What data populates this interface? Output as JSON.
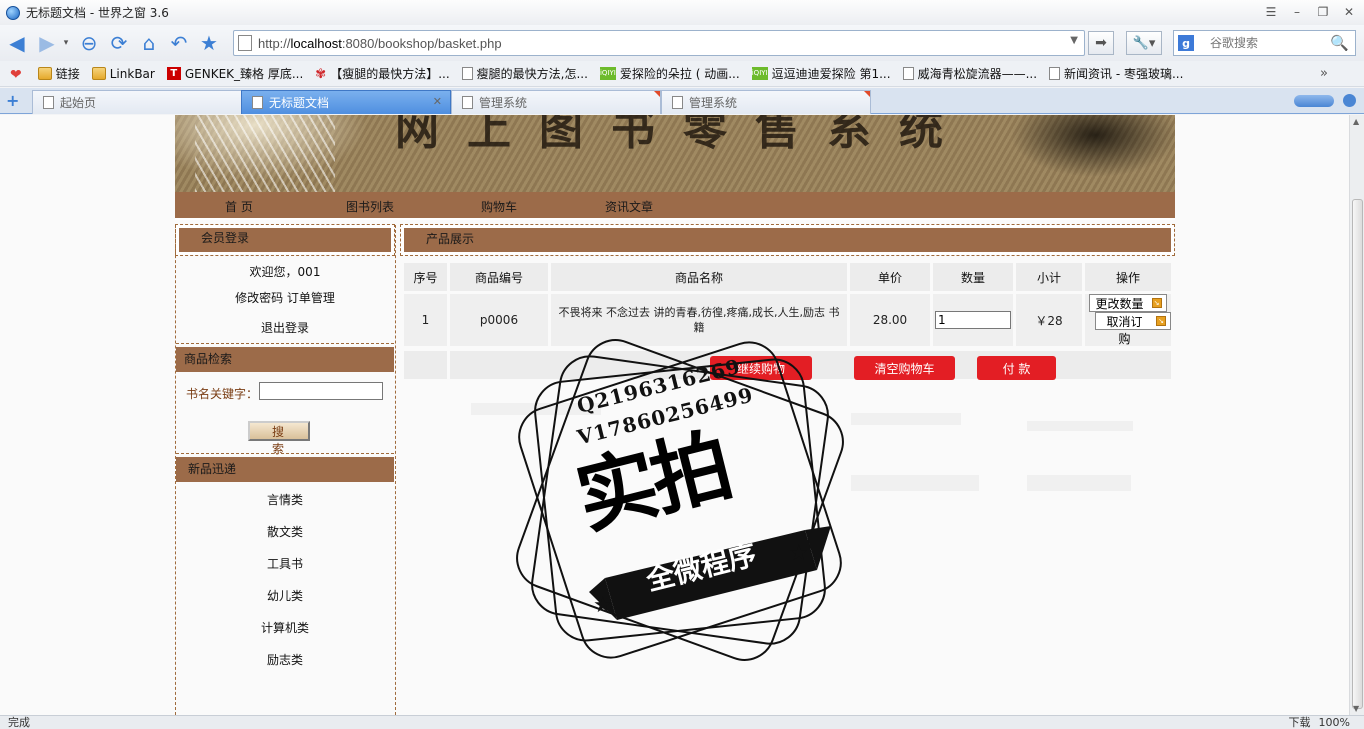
{
  "window": {
    "title": "无标题文档 - 世界之窗 3.6",
    "minimize": "–",
    "restore": "❐",
    "close": "✕"
  },
  "toolbar": {
    "back": "◀",
    "forward": "▶",
    "stop": "⊖",
    "refresh": "⟳",
    "home": "⌂",
    "undo": "↶",
    "favorite": "★",
    "url_prefix": "http://",
    "url_host": "localhost",
    "url_rest": ":8080/bookshop/basket.php",
    "go": "➡",
    "tools": "🔧▾",
    "search_placeholder": "谷歌搜索",
    "search_engine": "g",
    "magnifier": "🔍"
  },
  "bookmarks": [
    {
      "icon": "heart",
      "label": ""
    },
    {
      "icon": "folder",
      "label": "链接"
    },
    {
      "icon": "folder",
      "label": "LinkBar"
    },
    {
      "icon": "t",
      "label": "GENKEK_臻格 厚底..."
    },
    {
      "icon": "red",
      "label": "【瘦腿的最快方法】..."
    },
    {
      "icon": "doc",
      "label": "瘦腿的最快方法,怎..."
    },
    {
      "icon": "iqiyi",
      "label": "爱探险的朵拉 ( 动画..."
    },
    {
      "icon": "iqiyi",
      "label": "逗逗迪迪爱探险 第1..."
    },
    {
      "icon": "doc",
      "label": "威海青松旋流器——..."
    },
    {
      "icon": "doc",
      "label": "新闻资讯 - 枣强玻璃..."
    }
  ],
  "bookmarks_more": "»",
  "tabs": [
    {
      "label": "起始页",
      "active": false
    },
    {
      "label": "无标题文档",
      "active": true
    },
    {
      "label": "管理系统",
      "active": false
    },
    {
      "label": "管理系统",
      "active": false
    }
  ],
  "tab_add": "+",
  "tab_close": "✕",
  "site": {
    "banner_title": "网上图书零售系统",
    "nav": [
      "首 页",
      "图书列表",
      "购物车",
      "资讯文章"
    ],
    "login": {
      "title": "会员登录",
      "welcome": "欢迎您，001",
      "links": "修改密码  订单管理",
      "logout": "退出登录"
    },
    "search": {
      "title": "商品检索",
      "label": "书名关键字：",
      "button": "搜 索"
    },
    "new_arrivals": {
      "title": "新品迅递",
      "categories": [
        "言情类",
        "散文类",
        "工具书",
        "幼儿类",
        "计算机类",
        "励志类"
      ]
    },
    "products": {
      "title": "产品展示",
      "headers": [
        "序号",
        "商品编号",
        "商品名称",
        "单价",
        "数量",
        "小计",
        "操作"
      ],
      "rows": [
        {
          "no": "1",
          "code": "p0006",
          "name": "不畏将来 不念过去  讲的青春,彷徨,疼痛,成长,人生,励志  书籍",
          "price": "28.00",
          "qty": "1",
          "subtotal": "￥28",
          "change_qty": "更改数量",
          "cancel": "取消订购"
        }
      ]
    },
    "actions": {
      "continue": "继续购物",
      "clear": "清空购物车",
      "pay": "付 款"
    }
  },
  "watermark": {
    "qq": "Q2196316269",
    "vx": "V17860256499",
    "big": "实拍",
    "ribbon": "全微程序"
  },
  "status": {
    "left": "完成",
    "download": "下载",
    "zoom": "100%"
  }
}
